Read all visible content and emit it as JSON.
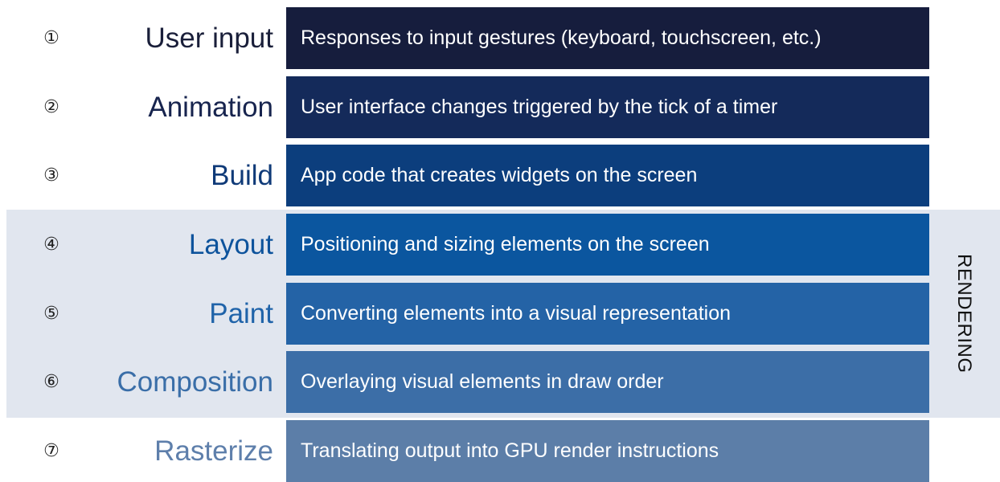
{
  "group_label": "RENDERING",
  "stages": [
    {
      "number": "①",
      "name": "User input",
      "description": "Responses to input gestures (keyboard, touchscreen, etc.)",
      "name_color": "#1a1f3a",
      "box_color": "#161d3d"
    },
    {
      "number": "②",
      "name": "Animation",
      "description": "User interface changes triggered by the tick of a timer",
      "name_color": "#17244e",
      "box_color": "#142a5a"
    },
    {
      "number": "③",
      "name": "Build",
      "description": "App code that creates widgets on the screen",
      "name_color": "#0f3a78",
      "box_color": "#0c3e7d"
    },
    {
      "number": "④",
      "name": "Layout",
      "description": "Positioning and sizing elements on the screen",
      "name_color": "#0d539c",
      "box_color": "#0b569f"
    },
    {
      "number": "⑤",
      "name": "Paint",
      "description": "Converting elements into a visual representation",
      "name_color": "#1f63a9",
      "box_color": "#2463a6"
    },
    {
      "number": "⑥",
      "name": "Composition",
      "description": "Overlaying visual elements in draw order",
      "name_color": "#3a6ea8",
      "box_color": "#3c6ea7"
    },
    {
      "number": "⑦",
      "name": "Rasterize",
      "description": "Translating output into GPU render instructions",
      "name_color": "#5e7fab",
      "box_color": "#5c7ea8"
    }
  ]
}
